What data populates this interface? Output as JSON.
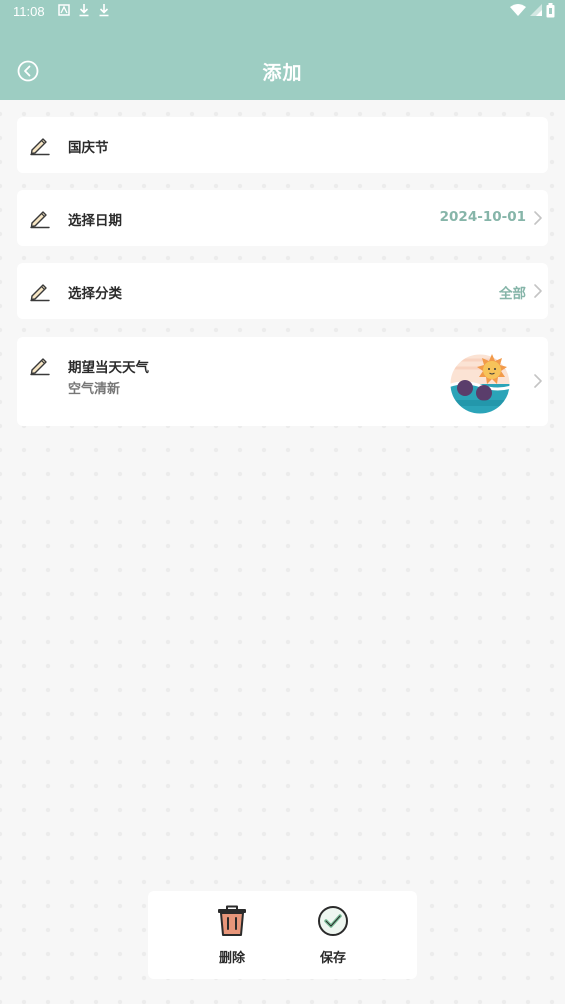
{
  "status_bar": {
    "time": "11:08"
  },
  "header": {
    "title": "添加"
  },
  "form": {
    "name": {
      "value": "国庆节"
    },
    "date": {
      "label": "选择日期",
      "value": "2024-10-01"
    },
    "category": {
      "label": "选择分类",
      "value": "全部"
    },
    "weather": {
      "label": "期望当天天气",
      "value": "空气清新"
    }
  },
  "actions": {
    "delete_label": "删除",
    "save_label": "保存"
  },
  "colors": {
    "header": "#9dcdc2",
    "accent": "#86b5a9",
    "delete": "#e8967a",
    "save": "#7cbf9a"
  }
}
